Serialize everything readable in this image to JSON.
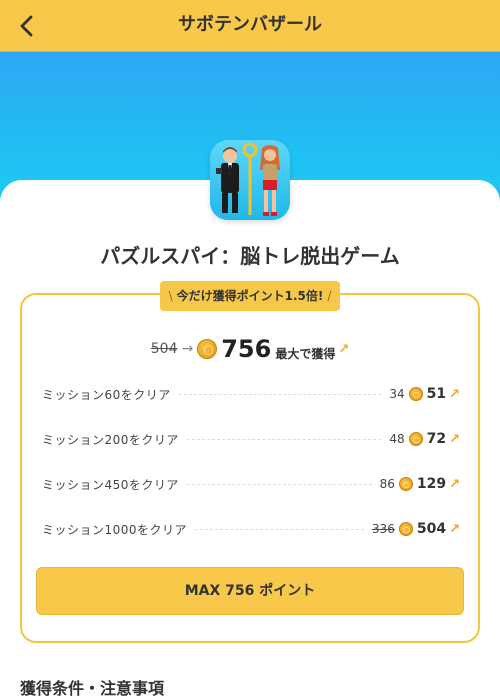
{
  "header": {
    "title": "サボテンバザール",
    "back_icon": "chevron-left-icon"
  },
  "colors": {
    "accent": "#f7c84a",
    "hero_top": "#2ea6f3",
    "hero_bottom": "#22cdf0",
    "card_border": "#f2c640"
  },
  "app": {
    "name": "パズルスパイ：脳トレ脱出ゲーム",
    "icon": "app-icon-spy-characters"
  },
  "promo": {
    "badge_text": "今だけ獲得ポイント1.5倍!",
    "badge_prefix": "\\",
    "badge_suffix": "/"
  },
  "total": {
    "old_points": "504",
    "new_points": "756",
    "suffix": "最大で獲得"
  },
  "missions": [
    {
      "label": "ミッション60をクリア",
      "old": "34",
      "new": "51",
      "strike": false
    },
    {
      "label": "ミッション200をクリア",
      "old": "48",
      "new": "72",
      "strike": false
    },
    {
      "label": "ミッション450をクリア",
      "old": "86",
      "new": "129",
      "strike": false
    },
    {
      "label": "ミッション1000をクリア",
      "old": "336",
      "new": "504",
      "strike": true
    }
  ],
  "cta": {
    "label": "MAX 756 ポイント"
  },
  "conditions": {
    "title": "獲得条件・注意事項"
  }
}
